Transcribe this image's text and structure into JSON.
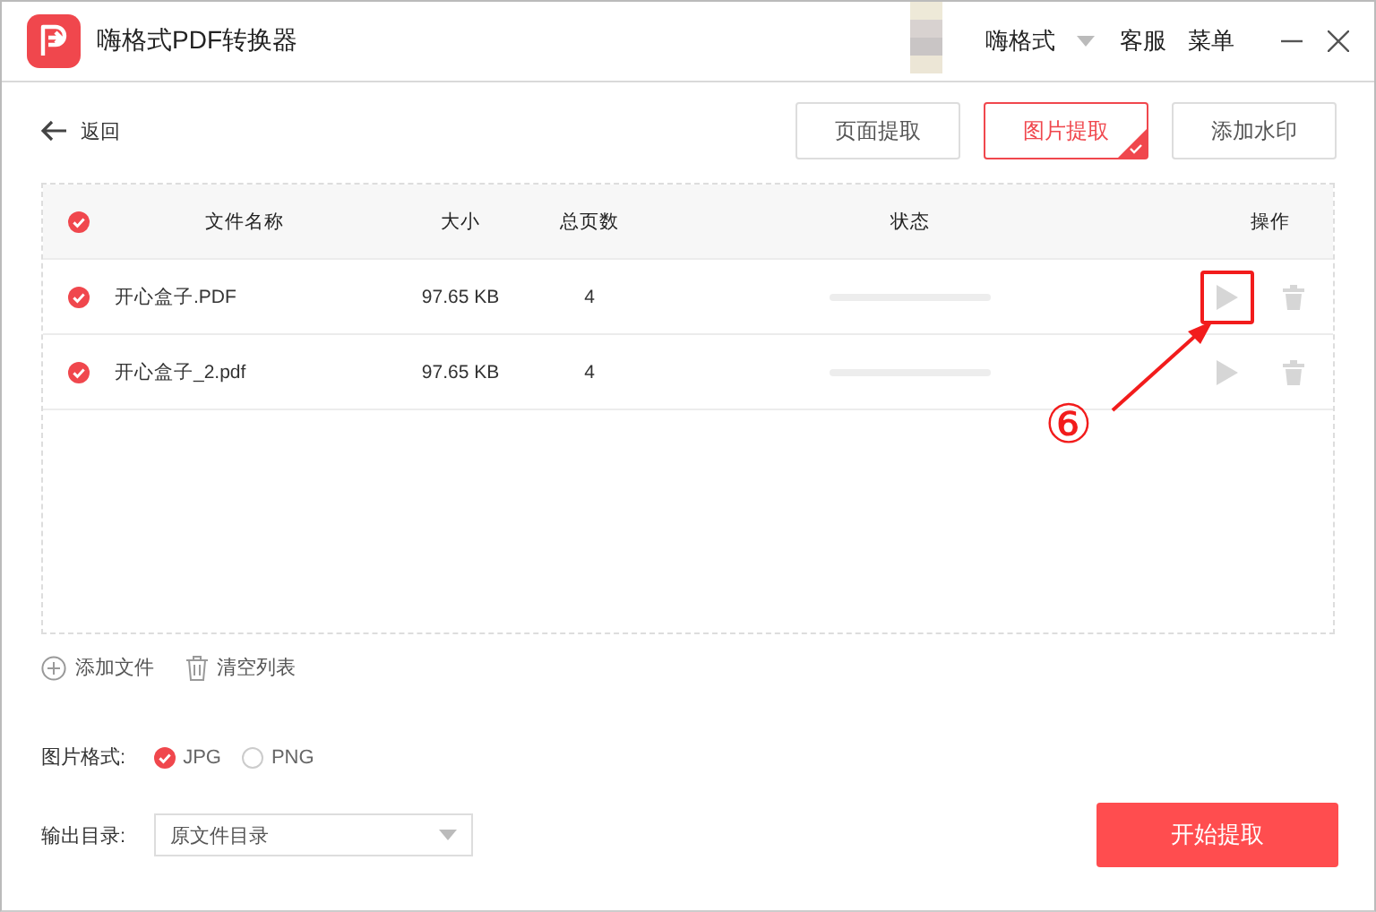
{
  "window": {
    "title": "嗨格式PDF转换器",
    "user": "嗨格式",
    "links": [
      "客服",
      "菜单"
    ]
  },
  "back": "返回",
  "mode_tabs": [
    {
      "label": "页面提取",
      "selected": false
    },
    {
      "label": "图片提取",
      "selected": true
    },
    {
      "label": "添加水印",
      "selected": false
    }
  ],
  "table": {
    "all_checked": true,
    "columns": [
      "文件名称",
      "大小",
      "总页数",
      "状态",
      "操作"
    ],
    "rows": [
      {
        "checked": true,
        "name": "开心盒子.PDF",
        "size": "97.65 KB",
        "pages": "4",
        "level": 0,
        "highlighted": true
      },
      {
        "checked": true,
        "name": "开心盒子_2.pdf",
        "size": "97.65 KB",
        "pages": "4",
        "level": 0,
        "highlighted": false
      }
    ]
  },
  "add_file": "添加文件",
  "clear_list": "清空列表",
  "format": {
    "label": "图片格式:",
    "options": [
      {
        "label": "JPG",
        "selected": true
      },
      {
        "label": "PNG",
        "selected": false
      }
    ]
  },
  "output": {
    "label": "输出目录:",
    "value": "原文件目录"
  },
  "start_button": "开始提取",
  "annotation": {
    "label": "⑥"
  }
}
